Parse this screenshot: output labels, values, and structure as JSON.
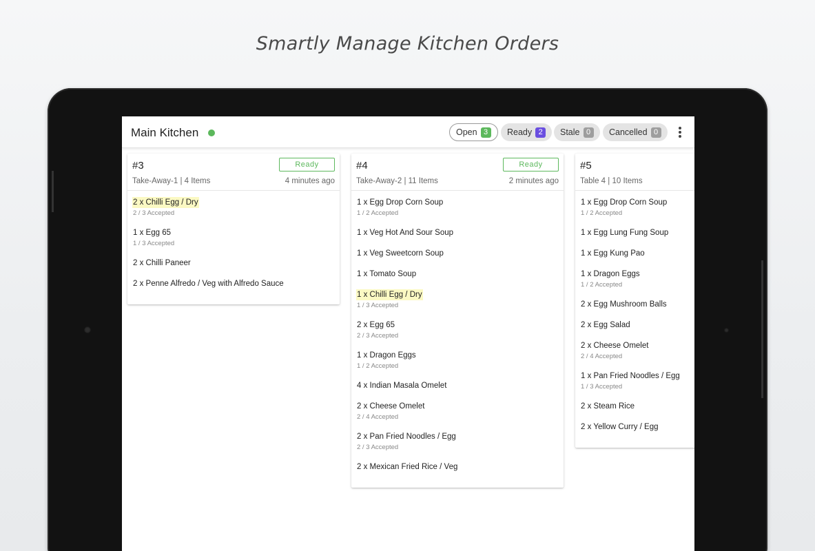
{
  "headline": "Smartly Manage Kitchen Orders",
  "appbar": {
    "title": "Main Kitchen",
    "status_color": "#5cb85c",
    "filters": [
      {
        "label": "Open",
        "count": "3",
        "badge_color": "#5cb85c",
        "active": true
      },
      {
        "label": "Ready",
        "count": "2",
        "badge_color": "#6a4fe0"
      },
      {
        "label": "Stale",
        "count": "0",
        "badge_color": "#9e9e9e"
      },
      {
        "label": "Cancelled",
        "count": "0",
        "badge_color": "#9e9e9e"
      }
    ],
    "more_icon": "more-vert-icon"
  },
  "orders": [
    {
      "number": "#3",
      "meta": "Take-Away-1 | 4 Items",
      "time": "4 minutes ago",
      "ready_label": "Ready",
      "items": [
        {
          "name": "2 x Chilli Egg / Dry",
          "sub": "2 / 3 Accepted",
          "highlight": true
        },
        {
          "name": "1 x Egg 65",
          "sub": "1 / 3 Accepted"
        },
        {
          "name": "2 x Chilli Paneer",
          "sub": ""
        },
        {
          "name": "2 x Penne Alfredo / Veg with Alfredo Sauce",
          "sub": ""
        }
      ]
    },
    {
      "number": "#4",
      "meta": "Take-Away-2 | 11 Items",
      "time": "2 minutes ago",
      "ready_label": "Ready",
      "items": [
        {
          "name": "1 x Egg Drop Corn Soup",
          "sub": "1 / 2 Accepted"
        },
        {
          "name": "1 x Veg Hot And Sour Soup",
          "sub": ""
        },
        {
          "name": "1 x Veg Sweetcorn Soup",
          "sub": ""
        },
        {
          "name": "1 x Tomato Soup",
          "sub": ""
        },
        {
          "name": "1 x Chilli Egg / Dry",
          "sub": "1 / 3 Accepted",
          "highlight": true
        },
        {
          "name": "2 x Egg 65",
          "sub": "2 / 3 Accepted"
        },
        {
          "name": "1 x Dragon Eggs",
          "sub": "1 / 2 Accepted"
        },
        {
          "name": "4 x Indian Masala Omelet",
          "sub": ""
        },
        {
          "name": "2 x Cheese Omelet",
          "sub": "2 / 4 Accepted"
        },
        {
          "name": "2 x Pan Fried Noodles / Egg",
          "sub": "2 / 3 Accepted"
        },
        {
          "name": "2 x Mexican Fried Rice / Veg",
          "sub": ""
        }
      ]
    },
    {
      "number": "#5",
      "meta": "Table 4 | 10 Items",
      "time": "",
      "ready_label": "",
      "items": [
        {
          "name": "1 x Egg Drop Corn Soup",
          "sub": "1 / 2 Accepted"
        },
        {
          "name": "1 x Egg Lung Fung Soup",
          "sub": ""
        },
        {
          "name": "1 x Egg Kung Pao",
          "sub": ""
        },
        {
          "name": "1 x Dragon Eggs",
          "sub": "1 / 2 Accepted"
        },
        {
          "name": "2 x Egg Mushroom Balls",
          "sub": ""
        },
        {
          "name": "2 x Egg Salad",
          "sub": ""
        },
        {
          "name": "2 x Cheese Omelet",
          "sub": "2 / 4 Accepted"
        },
        {
          "name": "1 x Pan Fried Noodles / Egg",
          "sub": "1 / 3 Accepted"
        },
        {
          "name": "2 x Steam Rice",
          "sub": ""
        },
        {
          "name": "2 x Yellow Curry / Egg",
          "sub": ""
        }
      ]
    }
  ]
}
